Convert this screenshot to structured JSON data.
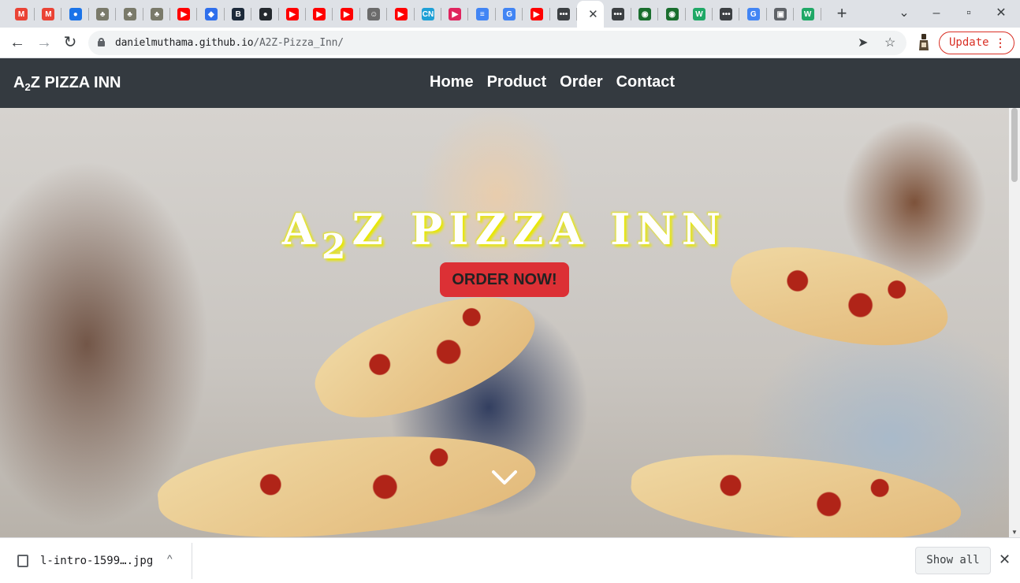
{
  "browser": {
    "tabs": [
      {
        "icon": "gmail-icon",
        "glyph": "M",
        "color": "#ea4335"
      },
      {
        "icon": "gmail-icon",
        "glyph": "M",
        "color": "#ea4335"
      },
      {
        "icon": "contacts-icon",
        "glyph": "●",
        "color": "#1a73e8"
      },
      {
        "icon": "tree-icon",
        "glyph": "♣",
        "color": "#7a7a6a"
      },
      {
        "icon": "tree-icon",
        "glyph": "♣",
        "color": "#7a7a6a"
      },
      {
        "icon": "tree-icon",
        "glyph": "♣",
        "color": "#7a7a6a"
      },
      {
        "icon": "youtube-icon",
        "glyph": "▶",
        "color": "#ff0000"
      },
      {
        "icon": "diamond-icon",
        "glyph": "◆",
        "color": "#2f6fec"
      },
      {
        "icon": "bootstrap-icon",
        "glyph": "B",
        "color": "#1d2a3a"
      },
      {
        "icon": "github-icon",
        "glyph": "●",
        "color": "#24292e"
      },
      {
        "icon": "youtube-icon",
        "glyph": "▶",
        "color": "#ff0000"
      },
      {
        "icon": "youtube-icon",
        "glyph": "▶",
        "color": "#ff0000"
      },
      {
        "icon": "youtube-icon",
        "glyph": "▶",
        "color": "#ff0000"
      },
      {
        "icon": "robot-icon",
        "glyph": "☺",
        "color": "#6b6b6b"
      },
      {
        "icon": "youtube-icon",
        "glyph": "▶",
        "color": "#ff0000"
      },
      {
        "icon": "cn-icon",
        "glyph": "CN",
        "color": "#1ea0d6"
      },
      {
        "icon": "media-icon",
        "glyph": "▶",
        "color": "#e0245e"
      },
      {
        "icon": "docs-icon",
        "glyph": "≡",
        "color": "#4285f4"
      },
      {
        "icon": "google-icon",
        "glyph": "G",
        "color": "#4285f4"
      },
      {
        "icon": "youtube-icon",
        "glyph": "▶",
        "color": "#ff0000"
      },
      {
        "icon": "chat-icon",
        "glyph": "•••",
        "color": "#3c4043"
      },
      {
        "icon": "active-tab-close-icon",
        "glyph": "",
        "color": ""
      },
      {
        "icon": "chat-icon",
        "glyph": "•••",
        "color": "#3c4043"
      },
      {
        "icon": "kenya-flag-icon",
        "glyph": "◉",
        "color": "#1a6e2e"
      },
      {
        "icon": "kenya-flag-icon",
        "glyph": "◉",
        "color": "#1a6e2e"
      },
      {
        "icon": "w-icon",
        "glyph": "W",
        "color": "#1fa866"
      },
      {
        "icon": "chat-icon",
        "glyph": "•••",
        "color": "#3c4043"
      },
      {
        "icon": "google-icon",
        "glyph": "G",
        "color": "#4285f4"
      },
      {
        "icon": "monitor-icon",
        "glyph": "▣",
        "color": "#5f6368"
      },
      {
        "icon": "w-icon",
        "glyph": "W",
        "color": "#1fa866"
      }
    ],
    "new_tab": "+",
    "tab_search": "⌄",
    "minimize": "–",
    "maximize": "▫",
    "close": "✕",
    "back": "←",
    "forward": "→",
    "reload": "↻",
    "url_host": "danielmuthama.github.io",
    "url_path": "/A2Z-Pizza_Inn/",
    "send_icon": "➤",
    "star_icon": "☆",
    "update_label": "Update",
    "update_menu": "⋮"
  },
  "site": {
    "brand": {
      "pre": "A",
      "sub": "2",
      "post": "Z PIZZA INN"
    },
    "nav": [
      "Home",
      "Product",
      "Order",
      "Contact"
    ],
    "hero": {
      "title": {
        "pre": "A",
        "sub": "2",
        "post": "Z PIZZA INN"
      },
      "cta": "ORDER NOW!"
    },
    "colors": {
      "navbar": "#343a40",
      "cta": "#dc3035",
      "title_glow": "#e8e800"
    }
  },
  "downloads": {
    "file_name": "l-intro-1599….jpg",
    "caret": "^",
    "show_all": "Show all",
    "close": "✕"
  }
}
